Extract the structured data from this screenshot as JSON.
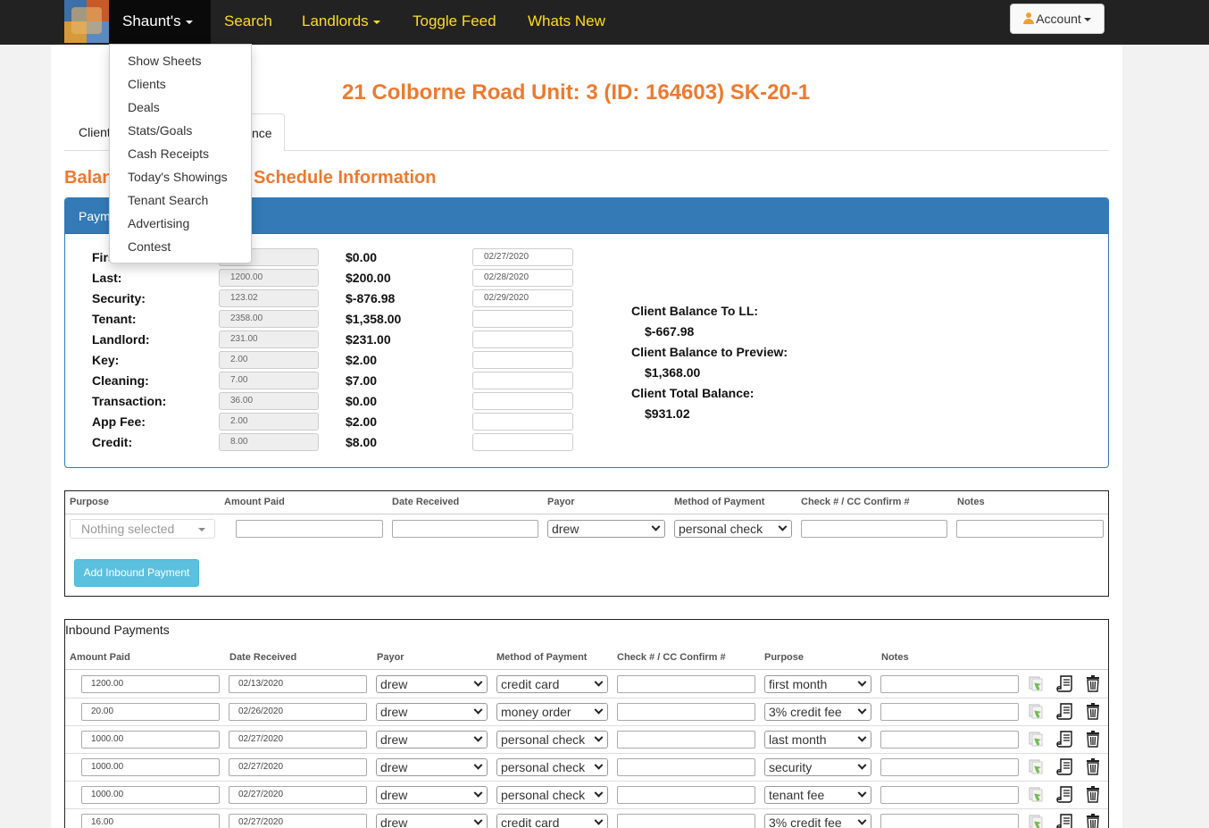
{
  "navbar": {
    "brand_menu_label": "Shaunt's",
    "items": [
      {
        "label": "Search"
      },
      {
        "label": "Landlords"
      },
      {
        "label": "Toggle Feed"
      },
      {
        "label": "Whats New"
      }
    ],
    "account_label": "Account",
    "colors": {
      "bar": "#222222",
      "link": "#ffdd1f"
    }
  },
  "dropdown": {
    "items": [
      "Show Sheets",
      "Clients",
      "Deals",
      "Stats/Goals",
      "Cash Receipts",
      "Today's Showings",
      "Tenant Search",
      "Advertising",
      "Contest"
    ]
  },
  "page": {
    "title": "21 Colborne Road Unit: 3 (ID: 164603) SK-20-1",
    "tabs": [
      {
        "label": "Client"
      },
      {
        "label": "nce"
      }
    ],
    "section_title_left": "Balan",
    "section_title_right": "Schedule Information",
    "accent_color": "#ed7a2f"
  },
  "payment_panel": {
    "heading": "Paym",
    "fees": [
      {
        "label": "Firs",
        "amount": ".00",
        "balance": "$0.00",
        "date": "02/27/2020"
      },
      {
        "label": "Last:",
        "amount": "1200.00",
        "balance": "$200.00",
        "date": "02/28/2020"
      },
      {
        "label": "Security:",
        "amount": "123.02",
        "balance": "$-876.98",
        "date": "02/29/2020"
      },
      {
        "label": "Tenant:",
        "amount": "2358.00",
        "balance": "$1,358.00",
        "date": ""
      },
      {
        "label": "Landlord:",
        "amount": "231.00",
        "balance": "$231.00",
        "date": ""
      },
      {
        "label": "Key:",
        "amount": "2.00",
        "balance": "$2.00",
        "date": ""
      },
      {
        "label": "Cleaning:",
        "amount": "7.00",
        "balance": "$7.00",
        "date": ""
      },
      {
        "label": "Transaction:",
        "amount": "36.00",
        "balance": "$0.00",
        "date": ""
      },
      {
        "label": "App Fee:",
        "amount": "2.00",
        "balance": "$2.00",
        "date": ""
      },
      {
        "label": "Credit:",
        "amount": "8.00",
        "balance": "$8.00",
        "date": ""
      }
    ],
    "balances": [
      {
        "label": "Client Balance To LL:",
        "value": "$-667.98"
      },
      {
        "label": "Client Balance to Preview:",
        "value": "$1,368.00"
      },
      {
        "label": "Client Total Balance:",
        "value": "$931.02"
      }
    ]
  },
  "add_payment": {
    "headers": [
      "Purpose",
      "Amount Paid",
      "Date Received",
      "Payor",
      "Method of Payment",
      "Check # / CC Confirm #",
      "Notes"
    ],
    "purpose_placeholder": "Nothing selected",
    "payor_value": "drew",
    "method_value": "personal check",
    "button_label": "Add Inbound Payment"
  },
  "inbound": {
    "caption": "Inbound Payments",
    "headers": [
      "Amount Paid",
      "Date Received",
      "Payor",
      "Method of Payment",
      "Check # / CC Confirm #",
      "Purpose",
      "Notes"
    ],
    "rows": [
      {
        "amount": "1200.00",
        "date": "02/13/2020",
        "payor": "drew",
        "method": "credit card",
        "confirm": "",
        "purpose": "first month",
        "notes": ""
      },
      {
        "amount": "20.00",
        "date": "02/26/2020",
        "payor": "drew",
        "method": "money order",
        "confirm": "",
        "purpose": "3% credit fee",
        "notes": ""
      },
      {
        "amount": "1000.00",
        "date": "02/27/2020",
        "payor": "drew",
        "method": "personal check",
        "confirm": "",
        "purpose": "last month",
        "notes": ""
      },
      {
        "amount": "1000.00",
        "date": "02/27/2020",
        "payor": "drew",
        "method": "personal check",
        "confirm": "",
        "purpose": "security",
        "notes": ""
      },
      {
        "amount": "1000.00",
        "date": "02/27/2020",
        "payor": "drew",
        "method": "personal check",
        "confirm": "",
        "purpose": "tenant fee",
        "notes": ""
      },
      {
        "amount": "16.00",
        "date": "02/27/2020",
        "payor": "drew",
        "method": "credit card",
        "confirm": "",
        "purpose": "3% credit fee",
        "notes": ""
      }
    ]
  }
}
